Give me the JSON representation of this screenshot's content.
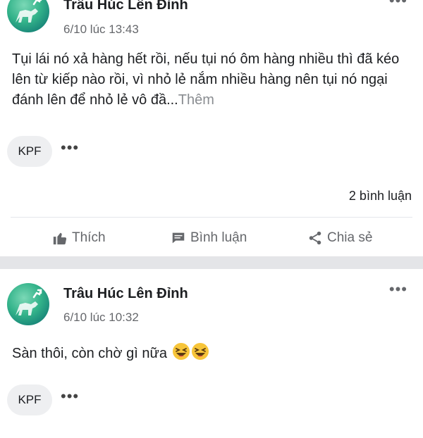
{
  "posts": [
    {
      "author": "Trâu Húc Lên Đỉnh",
      "time": "6/10 lúc 13:43",
      "text": "Tụi lái nó xả hàng hết rồi, nếu tụi nó ôm hàng nhiều thì đã kéo lên từ kiếp nào rồi, vì nhỏ lẻ nắm nhiều hàng nên tụi nó ngại đánh lên để nhỏ lẻ vô đầ...",
      "see_more": "Thêm",
      "reaction_chip": "KPF",
      "more_dots": "•••",
      "comment_count": "2 bình luận",
      "actions": {
        "like": "Thích",
        "comment": "Bình luận",
        "share": "Chia sẻ"
      }
    },
    {
      "author": "Trâu Húc Lên Đỉnh",
      "time": "6/10 lúc 10:32",
      "text": "Sàn thôi, còn chờ gì nữa",
      "emojis": [
        "laughing-face",
        "laughing-face"
      ],
      "reaction_chip": "KPF",
      "more_dots": "•••"
    }
  ],
  "header_more": "•••",
  "colors": {
    "text": "#1c1e21",
    "secondary": "#65676b",
    "separator": "#e4e5e8"
  }
}
